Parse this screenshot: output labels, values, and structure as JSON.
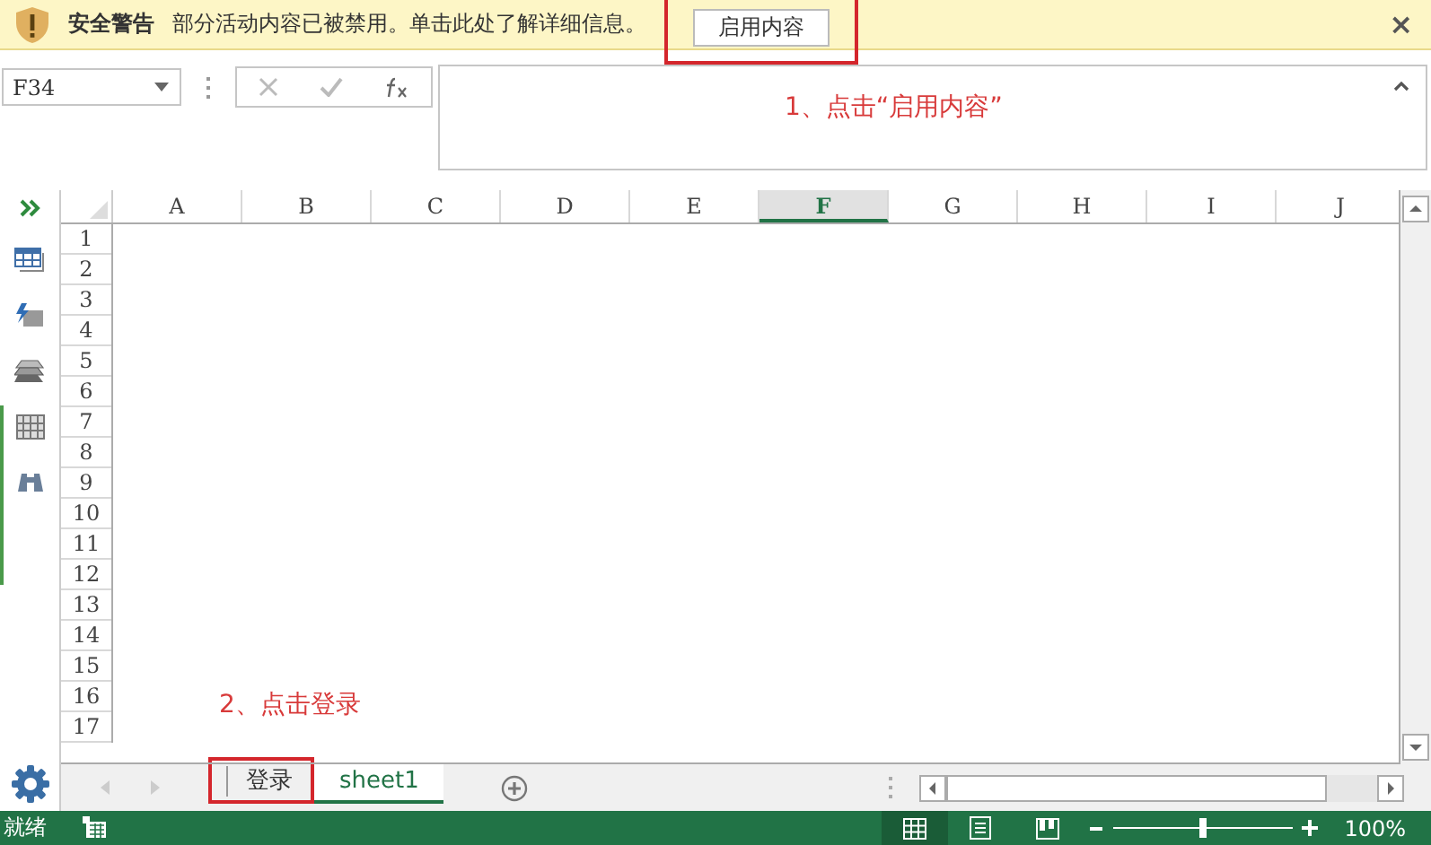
{
  "security_bar": {
    "title": "安全警告",
    "message": "部分活动内容已被禁用。单击此处了解详细信息。",
    "button": {
      "label": "启用内容",
      "highlighted": true
    },
    "close": "×"
  },
  "formula_bar": {
    "name_box": "F34",
    "annotation": "1、点击“启用内容”"
  },
  "columns": [
    {
      "label": "A",
      "selected": false
    },
    {
      "label": "B",
      "selected": false
    },
    {
      "label": "C",
      "selected": false
    },
    {
      "label": "D",
      "selected": false
    },
    {
      "label": "E",
      "selected": false
    },
    {
      "label": "F",
      "selected": true
    },
    {
      "label": "G",
      "selected": false
    },
    {
      "label": "H",
      "selected": false
    },
    {
      "label": "I",
      "selected": false
    },
    {
      "label": "J",
      "selected": false
    }
  ],
  "rows": [
    "1",
    "2",
    "3",
    "4",
    "5",
    "6",
    "7",
    "8",
    "9",
    "10",
    "11",
    "12",
    "13",
    "14",
    "15",
    "16",
    "17"
  ],
  "grid_annotation": "2、点击登录",
  "sheet_tabs": [
    {
      "label": "登录",
      "selected": false,
      "highlighted": true
    },
    {
      "label": "sheet1",
      "selected": true,
      "highlighted": false
    }
  ],
  "status_bar": {
    "status": "就绪",
    "views": [
      {
        "kind": "normal",
        "selected": true
      },
      {
        "kind": "page-layout",
        "selected": false
      },
      {
        "kind": "page-break",
        "selected": false
      }
    ],
    "zoom_slider": {
      "level": 0.5
    },
    "zoom": "100%"
  }
}
